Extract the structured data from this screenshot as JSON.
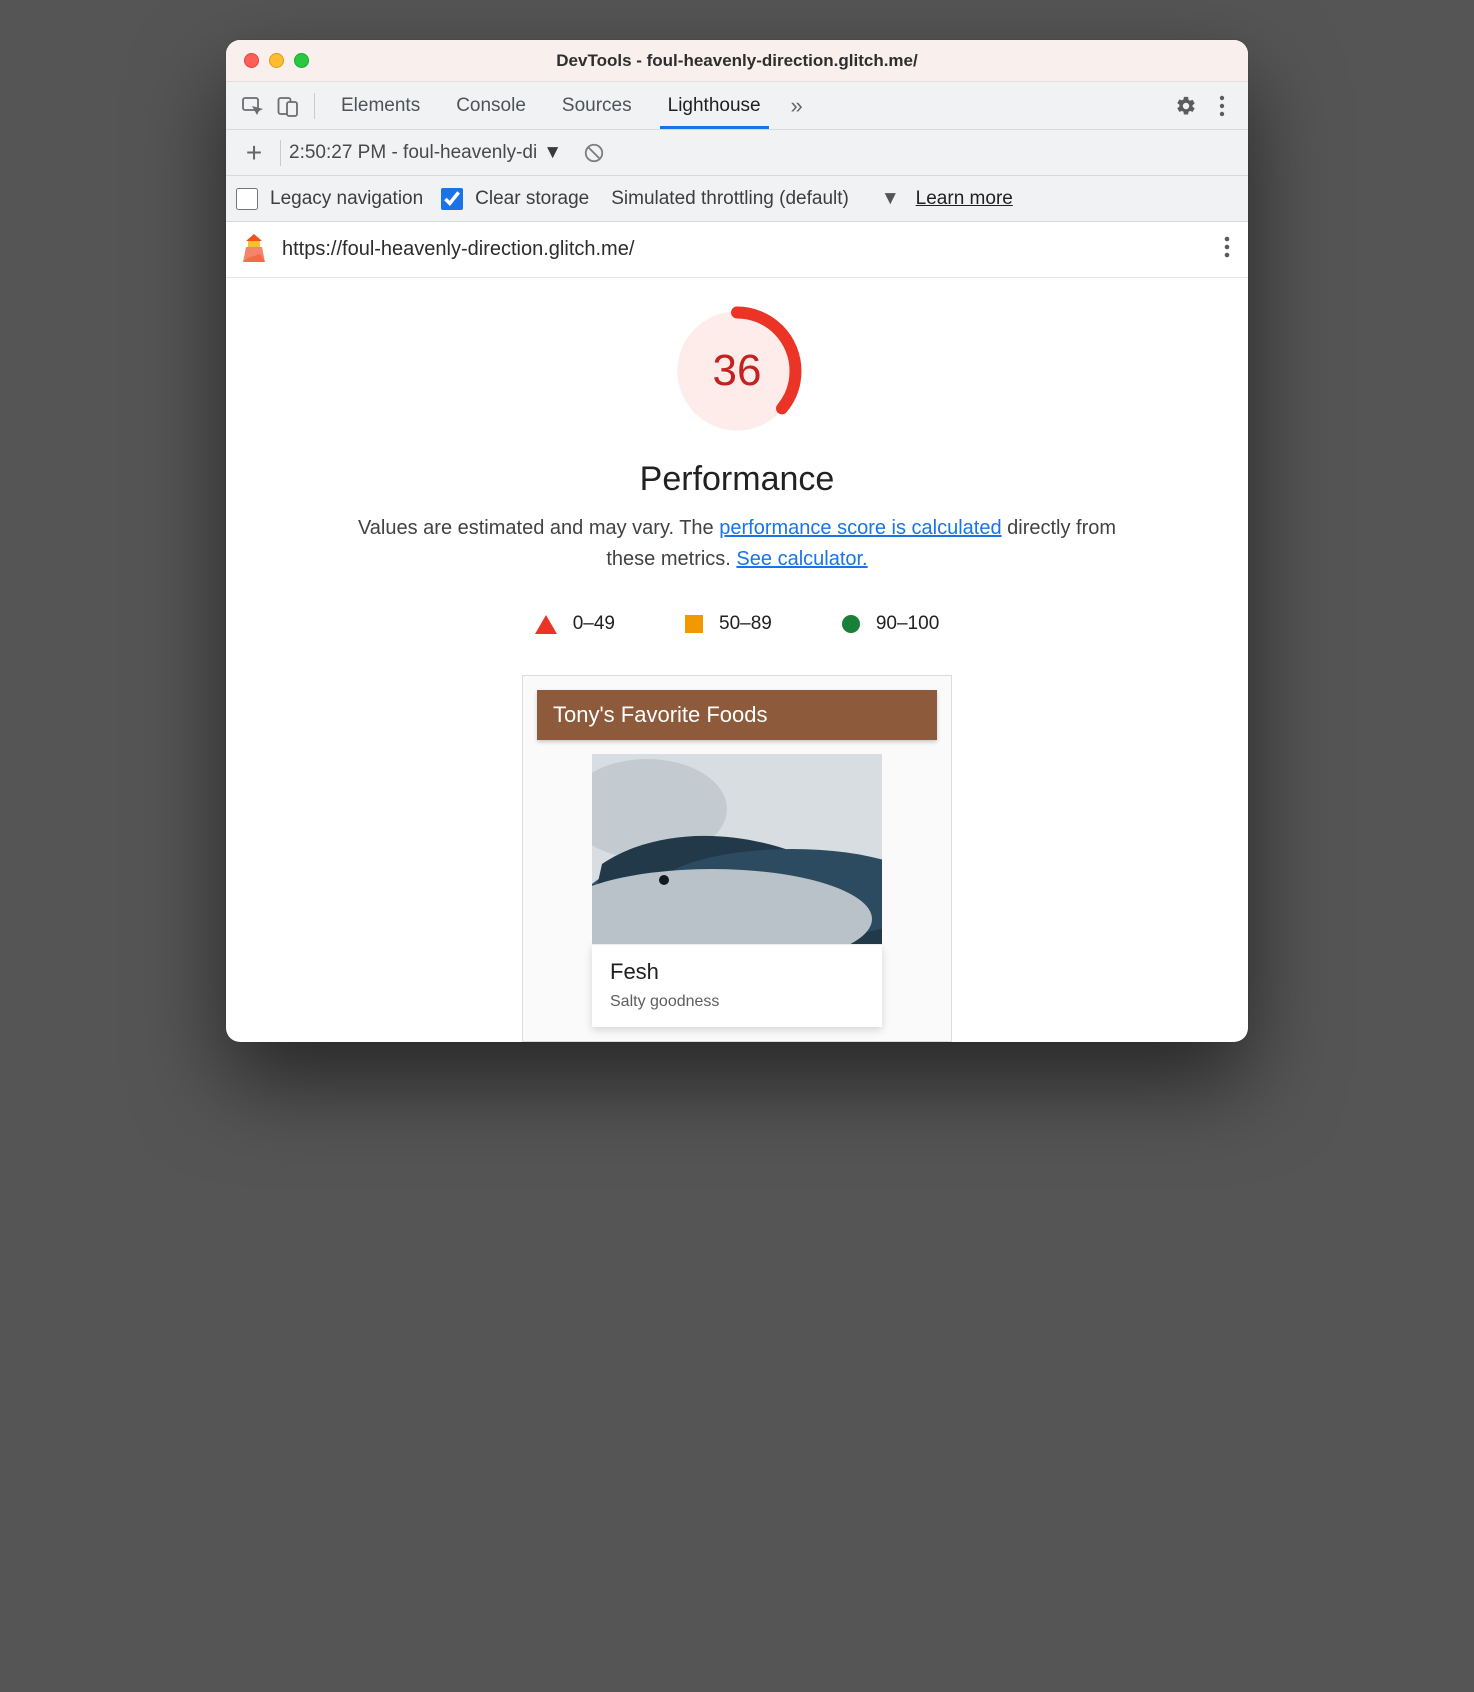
{
  "window": {
    "title": "DevTools - foul-heavenly-direction.glitch.me/"
  },
  "tabs": {
    "elements": "Elements",
    "console": "Console",
    "sources": "Sources",
    "lighthouse": "Lighthouse"
  },
  "toolbar2": {
    "report_select": "2:50:27 PM - foul-heavenly-di"
  },
  "options": {
    "legacy_label": "Legacy navigation",
    "clear_label": "Clear storage",
    "throttle_label": "Simulated throttling (default)",
    "learn_more": "Learn more"
  },
  "report": {
    "url": "https://foul-heavenly-direction.glitch.me/",
    "score": "36",
    "category": "Performance",
    "desc_prefix": "Values are estimated and may vary. The ",
    "desc_link1": "performance score is calculated",
    "desc_mid": " directly from these metrics. ",
    "desc_link2": "See calculator.",
    "legend": {
      "bad": "0–49",
      "avg": "50–89",
      "good": "90–100"
    },
    "preview": {
      "header": "Tony's Favorite Foods",
      "item_title": "Fesh",
      "item_sub": "Salty goodness"
    }
  }
}
